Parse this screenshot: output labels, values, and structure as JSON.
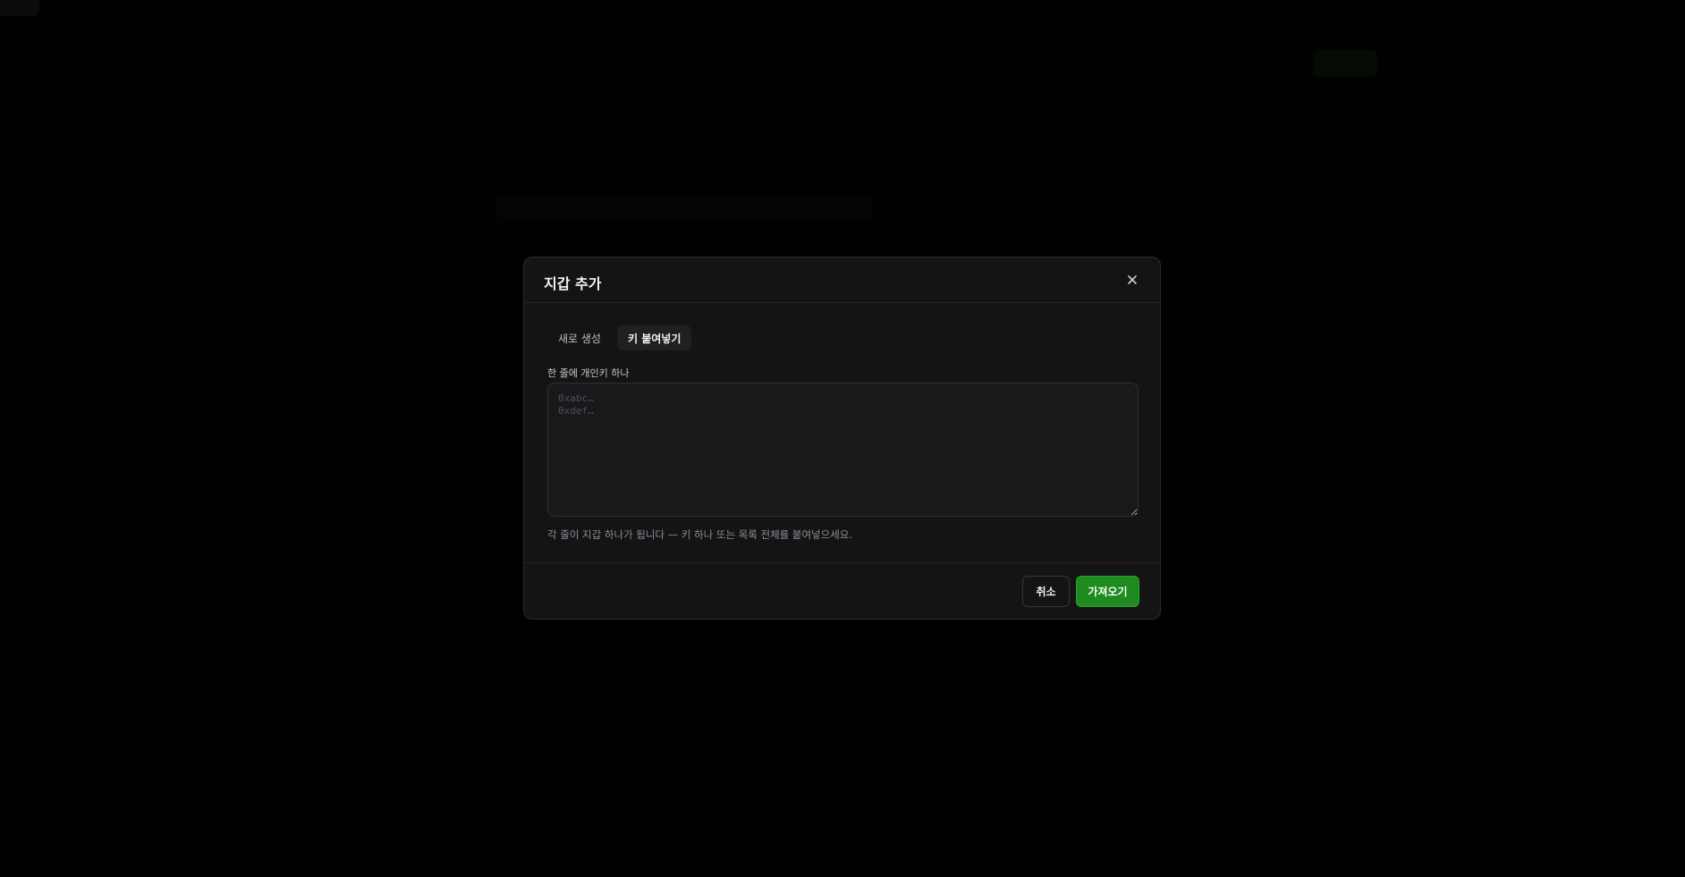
{
  "modal": {
    "title": "지갑 추가",
    "close_icon": "close-icon",
    "tabs": [
      {
        "label": "새로 생성",
        "active": false
      },
      {
        "label": "키 붙여넣기",
        "active": true
      }
    ],
    "field_label": "한 줄에 개인키 하나",
    "textarea_placeholder": "0xabc…\n0xdef…",
    "textarea_value": "",
    "help_text": "각 줄이 지갑 하나가 됩니다 — 키 하나 또는 목록 전체를 붙여넣으세요.",
    "cancel_label": "취소",
    "import_label": "가져오기"
  },
  "colors": {
    "accent_green": "#1f8a1f",
    "modal_bg": "#141416",
    "overlay": "#000000"
  }
}
